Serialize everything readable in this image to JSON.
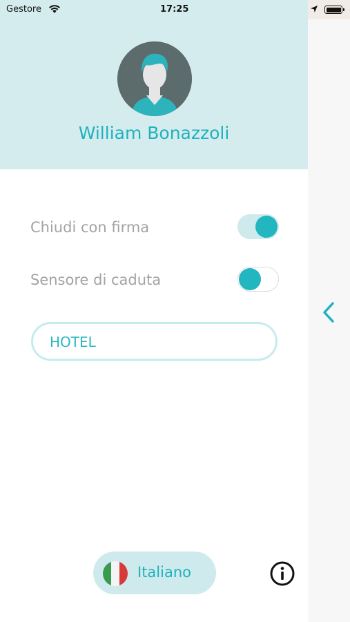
{
  "status_bar": {
    "carrier": "Gestore",
    "time": "17:25"
  },
  "profile": {
    "name": "William Bonazzoli"
  },
  "settings": [
    {
      "label": "Chiudi con firma",
      "enabled": true
    },
    {
      "label": "Sensore di caduta",
      "enabled": false
    }
  ],
  "hotel_field": {
    "value": "HOTEL"
  },
  "footer": {
    "language_label": "Italiano",
    "flag_colors": [
      "#3a9a4e",
      "#ffffff",
      "#d83a3a"
    ]
  },
  "colors": {
    "accent": "#1fb2bd",
    "header_bg": "#d5ecee",
    "toggle_track_on": "#cfeaec",
    "label_gray": "#a3a3a3"
  },
  "icons": [
    "wifi-icon",
    "location-arrow-icon",
    "battery-icon",
    "avatar-icon",
    "info-icon",
    "chevron-left-icon",
    "italy-flag-icon"
  ]
}
